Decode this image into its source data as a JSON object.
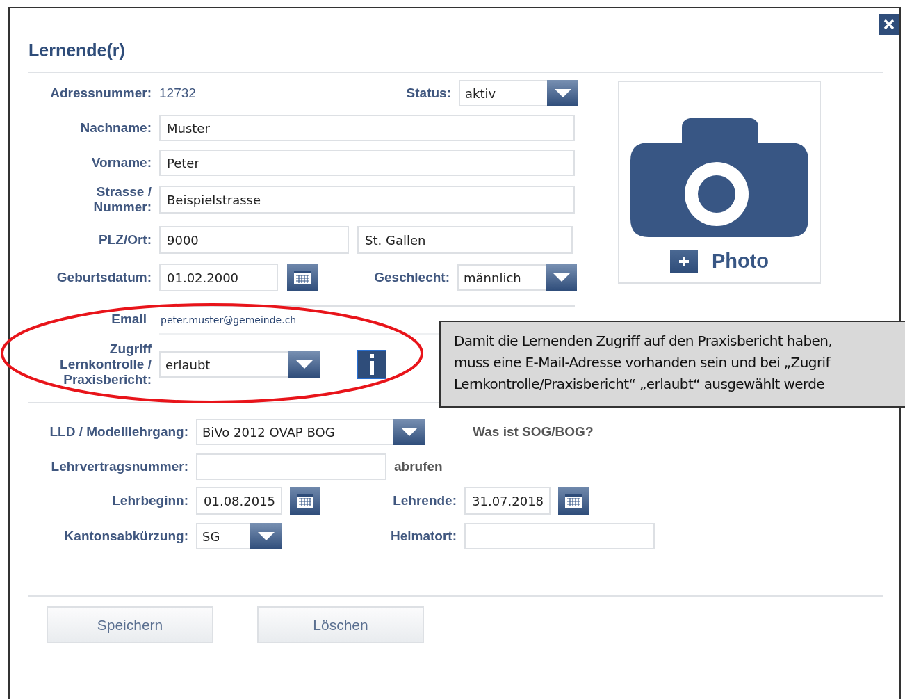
{
  "dialog": {
    "title": "Lernende(r)"
  },
  "address_number": {
    "label": "Adressnummer:",
    "value": "12732"
  },
  "status": {
    "label": "Status:",
    "value": "aktiv"
  },
  "last_name": {
    "label": "Nachname:",
    "value": "Muster"
  },
  "first_name": {
    "label": "Vorname:",
    "value": "Peter"
  },
  "street": {
    "label_lines": [
      "Strasse /",
      "Nummer:"
    ],
    "value": "Beispielstrasse"
  },
  "plz_ort": {
    "label": "PLZ/Ort:",
    "plz": "9000",
    "ort": "St. Gallen"
  },
  "birthdate": {
    "label": "Geburtsdatum:",
    "value": "01.02.2000"
  },
  "gender": {
    "label": "Geschlecht:",
    "value": "männlich"
  },
  "email": {
    "label": "Email",
    "value": "peter.muster@gemeinde.ch"
  },
  "access": {
    "label_lines": [
      "Zugriff",
      "Lernkontrolle /",
      "Praxisbericht:"
    ],
    "value": "erlaubt"
  },
  "photo": {
    "label": "Photo"
  },
  "tooltip": {
    "lines": [
      "Damit die Lernenden Zugriff auf den Praxisbericht haben,",
      "muss eine E-Mail-Adresse vorhanden sein und bei „Zugrif",
      "Lernkontrolle/Praxisbericht“ „erlaubt“ ausgewählt werde"
    ]
  },
  "model": {
    "label": "LLD / Modelllehrgang:",
    "value": "BiVo 2012 OVAP BOG",
    "link": "Was ist SOG/BOG?"
  },
  "contract": {
    "label": "Lehrvertragsnummer:",
    "link": "abrufen"
  },
  "start": {
    "label": "Lehrbeginn:",
    "value": "01.08.2015"
  },
  "end": {
    "label": "Lehrende:",
    "value": "31.07.2018"
  },
  "canton": {
    "label": "Kantonsabkürzung:",
    "value": "SG"
  },
  "home": {
    "label": "Heimatort:"
  },
  "buttons": [
    "Speichern",
    "Löschen"
  ]
}
